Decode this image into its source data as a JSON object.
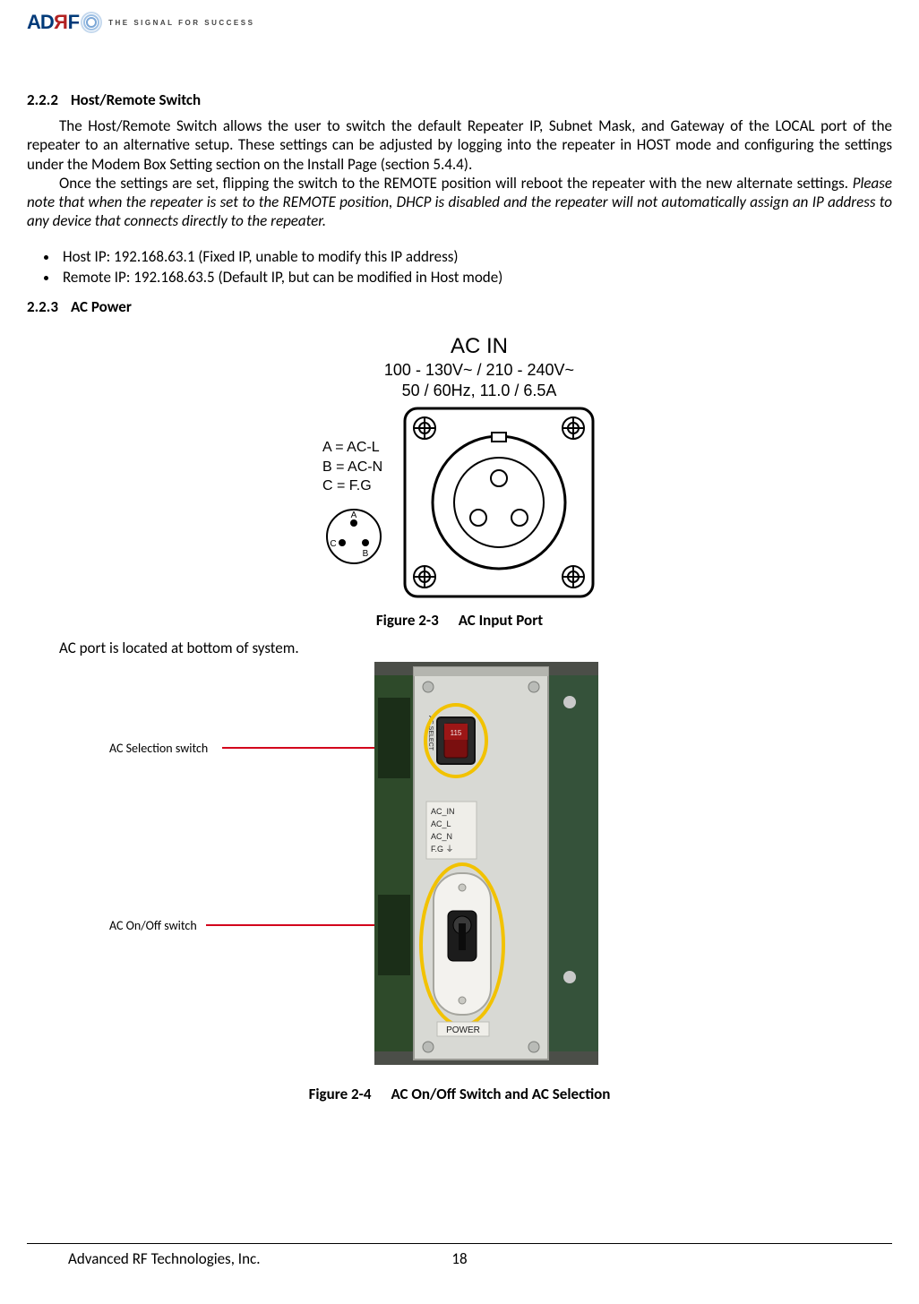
{
  "header": {
    "logo_ad": "AD",
    "logo_r": "R",
    "logo_f": "F",
    "tagline": "THE SIGNAL FOR SUCCESS"
  },
  "section222": {
    "num": "2.2.2",
    "title": "Host/Remote Switch",
    "para1": "The Host/Remote Switch allows the user to switch the default Repeater IP, Subnet Mask, and Gateway of the LOCAL port of the repeater to an alternative setup.  These settings can be adjusted by logging into the repeater in HOST mode and configuring the settings under the Modem Box Setting section on the Install Page (section 5.4.4).",
    "para2a": "Once the settings are set, flipping the switch to the REMOTE position will reboot the repeater with the new alternate settings.  ",
    "para2b": "Please note that when the repeater is set to the REMOTE position, DHCP is disabled and the repeater will not automatically assign an IP address to any device that connects directly to the repeater.",
    "bullets": [
      "Host IP: 192.168.63.1 (Fixed IP, unable to modify this IP address)",
      "Remote IP: 192.168.63.5 (Default IP, but can be modified in Host mode)"
    ]
  },
  "section223": {
    "num": "2.2.3",
    "title": "AC Power"
  },
  "figure23": {
    "ac_in": "AC IN",
    "spec1": "100 - 130V~ / 210 - 240V~",
    "spec2": "50 / 60Hz, 11.0 / 6.5A",
    "legendA": "A = AC-L",
    "legendB": "B = AC-N",
    "legendC": "C = F.G",
    "pinA": "A",
    "pinB": "B",
    "pinC": "C",
    "caption_num": "Figure 2-3",
    "caption_title": "AC Input Port",
    "after": "AC port is located at bottom of system."
  },
  "figure24": {
    "callout_sel": "AC Selection switch",
    "callout_on": "AC On/Off switch",
    "caption_num": "Figure 2-4",
    "caption_title": "AC On/Off Switch and AC Selection",
    "photo_labels": {
      "ac_select": "AC SELECT",
      "ac_in": "AC_IN",
      "ac_l": "AC_L",
      "ac_n": "AC_N",
      "fg": "F.G ⏚",
      "power": "POWER",
      "switch_115": "115"
    }
  },
  "footer": {
    "company": "Advanced RF Technologies, Inc.",
    "page": "18"
  }
}
